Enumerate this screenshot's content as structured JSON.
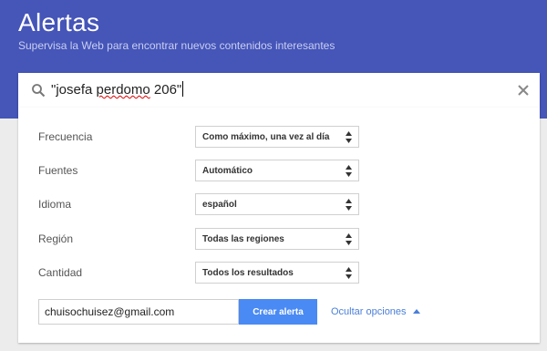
{
  "header": {
    "title": "Alertas",
    "subtitle": "Supervisa la Web para encontrar nuevos contenidos interesantes"
  },
  "search": {
    "query_before": "\"josefa ",
    "query_misspelled": "perdomo",
    "query_after": " 206\"",
    "search_icon": "search-icon",
    "clear_icon": "close-icon"
  },
  "options": [
    {
      "label": "Frecuencia",
      "value": "Como máximo, una vez al día"
    },
    {
      "label": "Fuentes",
      "value": "Automático"
    },
    {
      "label": "Idioma",
      "value": "español"
    },
    {
      "label": "Región",
      "value": "Todas las regiones"
    },
    {
      "label": "Cantidad",
      "value": "Todos los resultados"
    }
  ],
  "delivery": {
    "email": "chuisochuisez@gmail.com",
    "create_label": "Crear alerta",
    "toggle_options_label": "Ocultar opciones"
  },
  "colors": {
    "header_bg": "#4555b8",
    "primary_button": "#4a8af4",
    "link": "#4a7fd9"
  }
}
